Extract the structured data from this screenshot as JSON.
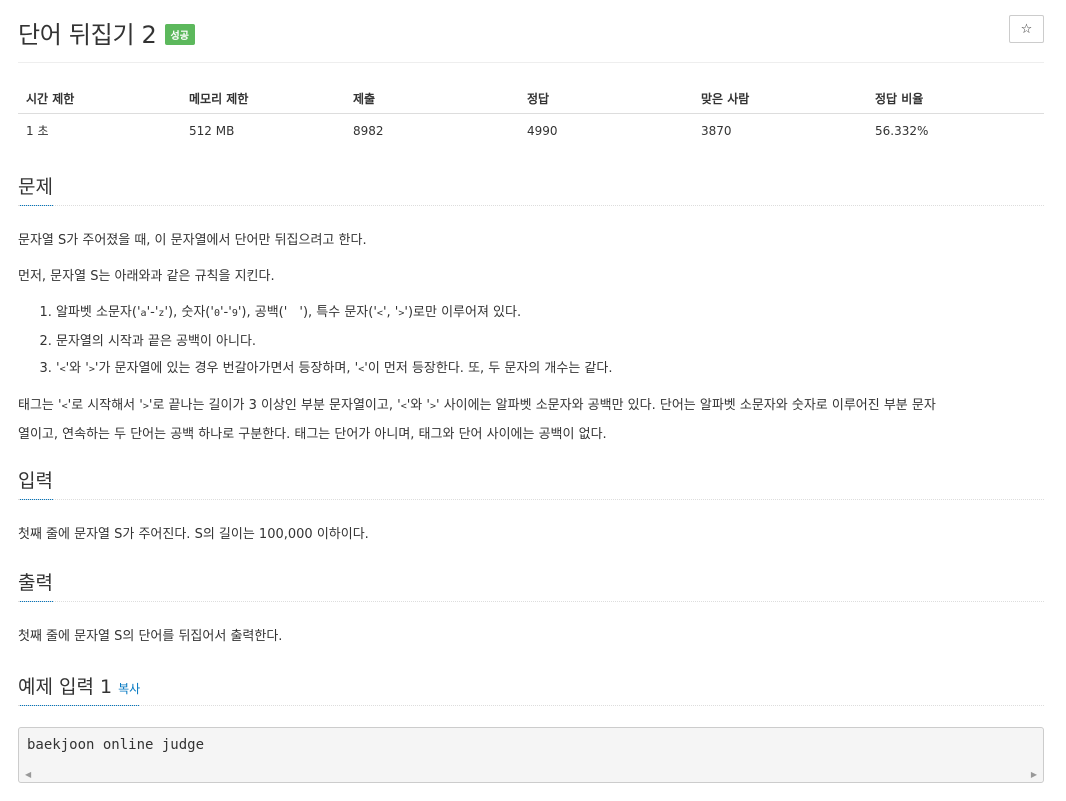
{
  "problem": {
    "title": "단어 뒤집기 2",
    "badge": "성공",
    "star_icon": "☆"
  },
  "stats": {
    "headers": [
      "시간 제한",
      "메모리 제한",
      "제출",
      "정답",
      "맞은 사람",
      "정답 비율"
    ],
    "values": [
      "1 초",
      "512 MB",
      "8982",
      "4990",
      "3870",
      "56.332%"
    ]
  },
  "sections": {
    "problem": "문제",
    "input": "입력",
    "output": "출력",
    "sample_input": "예제 입력 1",
    "copy": "복사"
  },
  "description": {
    "p1": "문자열 S가 주어졌을 때, 이 문자열에서 단어만 뒤집으려고 한다.",
    "p2": "먼저, 문자열 S는 아래와과 같은 규칙을 지킨다.",
    "rule1": {
      "a": "알파벳 소문자('",
      "b": "a",
      "c": "'-'",
      "d": "z",
      "e": "'), 숫자('",
      "f": "0",
      "g": "'-'",
      "h": "9",
      "i": "'), 공백('",
      "j": " ",
      "k": "'), 특수 문자('",
      "l": "<",
      "m": "', '",
      "n": ">",
      "o": "')로만 이루어져 있다."
    },
    "rule2": "문자열의 시작과 끝은 공백이 아니다.",
    "rule3": {
      "a": "'",
      "b": "<",
      "c": "'와 '",
      "d": ">",
      "e": "'가 문자열에 있는 경우 번갈아가면서 등장하며, '",
      "f": "<",
      "g": "'이 먼저 등장한다. 또, 두 문자의 개수는 같다."
    },
    "p3": {
      "a": "태그는 '",
      "b": "<",
      "c": "'로 시작해서 '",
      "d": ">",
      "e": "'로 끝나는 길이가 3 이상인 부분 문자열이고, '",
      "f": "<",
      "g": "'와 '",
      "h": ">",
      "i": "' 사이에는 알파벳 소문자와 공백만 있다. 단어는 알파벳 소문자와 숫자로 이루어진 부분 문자",
      "line2": "열이고, 연속하는 두 단어는 공백 하나로 구분한다. 태그는 단어가 아니며, 태그와 단어 사이에는 공백이 없다."
    }
  },
  "input_text": "첫째 줄에 문자열 S가 주어진다. S의 길이는 100,000 이하이다.",
  "output_text": "첫째 줄에 문자열 S의 단어를 뒤집어서 출력한다.",
  "sample_input_text": "baekjoon online judge"
}
